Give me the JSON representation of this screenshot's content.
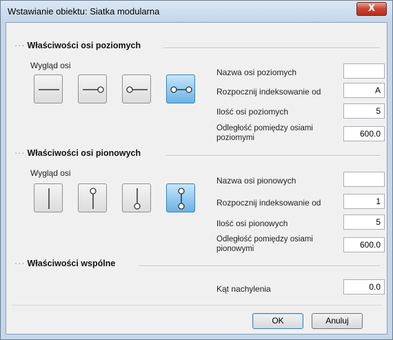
{
  "window": {
    "title": "Wstawianie obiektu: Siatka modularna",
    "close_label": "X"
  },
  "horizontal": {
    "section_title": "Właściwości osi poziomych",
    "appearance_label": "Wygląd osi",
    "fields": {
      "name": {
        "label": "Nazwa osi poziomych",
        "value": ""
      },
      "start": {
        "label": "Rozpocznij indeksowanie od",
        "value": "A"
      },
      "count": {
        "label": "Ilość osi poziomych",
        "value": "5"
      },
      "spacing": {
        "label_line1": "Odległość pomiędzy osiami",
        "label_line2": "poziomymi",
        "value": "600.0"
      }
    },
    "styles": [
      {
        "icon": "line-plain-icon",
        "selected": false
      },
      {
        "icon": "line-bubble-end-icon",
        "selected": false
      },
      {
        "icon": "line-bubble-start-icon",
        "selected": false
      },
      {
        "icon": "line-bubble-both-icon",
        "selected": true
      }
    ]
  },
  "vertical": {
    "section_title": "Właściwości osi pionowych",
    "appearance_label": "Wygląd osi",
    "fields": {
      "name": {
        "label": "Nazwa osi pionowych",
        "value": ""
      },
      "start": {
        "label": "Rozpocznij indeksowanie od",
        "value": "1"
      },
      "count": {
        "label": "Ilość osi pionowych",
        "value": "5"
      },
      "spacing": {
        "label_line1": "Odległość pomiędzy osiami",
        "label_line2": "pionowymi",
        "value": "600.0"
      }
    },
    "styles": [
      {
        "icon": "vline-plain-icon",
        "selected": false
      },
      {
        "icon": "vline-bubble-top-icon",
        "selected": false
      },
      {
        "icon": "vline-bubble-bottom-icon",
        "selected": false
      },
      {
        "icon": "vline-bubble-both-icon",
        "selected": true
      }
    ]
  },
  "common": {
    "section_title": "Właściwości wspólne",
    "angle": {
      "label": "Kąt nachylenia",
      "value": "0.0"
    }
  },
  "buttons": {
    "ok": "OK",
    "cancel": "Anuluj"
  },
  "colors": {
    "selected_bg": "#6ab3e6",
    "title_bar": "#c4d6ea",
    "close_red": "#c8432f"
  }
}
